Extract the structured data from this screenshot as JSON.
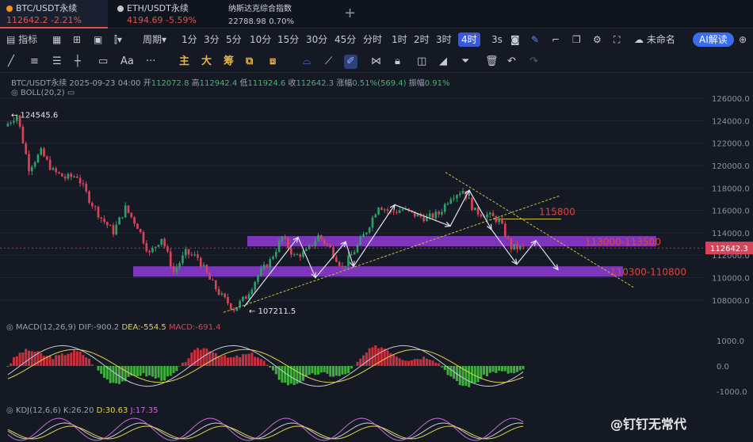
{
  "tabs": [
    {
      "name": "BTC/USDT永续",
      "price": "112642.2",
      "change": "-2.21%",
      "color": "#f7931a",
      "active": true
    },
    {
      "name": "ETH/USDT永续",
      "price": "4194.69",
      "change": "-5.59%",
      "color": "#c9c9c9",
      "active": false
    },
    {
      "name": "纳斯达克综合指数",
      "price": "22788.98",
      "change": "0.70%",
      "color": "",
      "active": false
    }
  ],
  "toolbar": {
    "indicator": "指标",
    "period": "周期",
    "intervals": [
      "1分",
      "3分",
      "5分",
      "10分",
      "15分",
      "30分",
      "45分",
      "分时",
      "1时",
      "2时",
      "3时",
      "4时"
    ],
    "active_interval": "4时",
    "seconds": "3s",
    "unnamed": "未命名",
    "ai": "AI解读"
  },
  "drawbar": {
    "main": "主",
    "big": "大",
    "chips": "筹",
    "text": "Aa"
  },
  "ohlc": {
    "symbol": "BTC/USDT永续",
    "time": "2025-09-23 04:00",
    "open_label": "开",
    "open": "112072.8",
    "high_label": "高",
    "high": "112942.4",
    "low_label": "低",
    "low": "111924.6",
    "close_label": "收",
    "close": "112642.3",
    "chg_label": "涨幅",
    "chg": "0.51%(569.4)",
    "amp_label": "振幅",
    "amp": "0.91%"
  },
  "boll": "BOLL(20,2)",
  "macd": {
    "name": "MACD(12,26,9)",
    "dif": "DIF:-900.2",
    "dea": "DEA:-554.5",
    "macd": "MACD:-691.4",
    "ticks": [
      "1000.0",
      "0.0",
      "-1000.0"
    ]
  },
  "kdj": {
    "name": "KDJ(12,6,6)",
    "k": "K:26.20",
    "d": "D:30.63",
    "j": "J:17.35"
  },
  "watermark": "@钉钉无常代",
  "chart_data": {
    "type": "candlestick",
    "y_ticks": [
      "126000.0",
      "124000.0",
      "122000.0",
      "120000.0",
      "118000.0",
      "116000.0",
      "114000.0",
      "112000.0",
      "110000.0",
      "108000.0"
    ],
    "ylim": [
      106500,
      127000
    ],
    "last_price": "112642.3",
    "high_label": "124545.6",
    "low_label": "107211.5",
    "zones": [
      {
        "label": "113000-113500",
        "low": 113000,
        "high": 113500,
        "color": "#8e3bd6"
      },
      {
        "label": "110300-110800",
        "low": 110300,
        "high": 110800,
        "color": "#8e3bd6"
      }
    ],
    "level": {
      "label": "115800",
      "value": 115800
    },
    "close_path": [
      123500,
      124545,
      119800,
      121200,
      119500,
      118900,
      119100,
      117000,
      115300,
      114100,
      116200,
      114600,
      112100,
      113600,
      110500,
      112200,
      111800,
      109800,
      108300,
      107211,
      108300,
      110200,
      111500,
      113600,
      111900,
      112300,
      113700,
      112600,
      110900,
      112400,
      114200,
      116500,
      115800,
      116100,
      115600,
      115300,
      115700,
      117300,
      117800,
      115900,
      115600,
      115100,
      112700,
      112642
    ]
  }
}
